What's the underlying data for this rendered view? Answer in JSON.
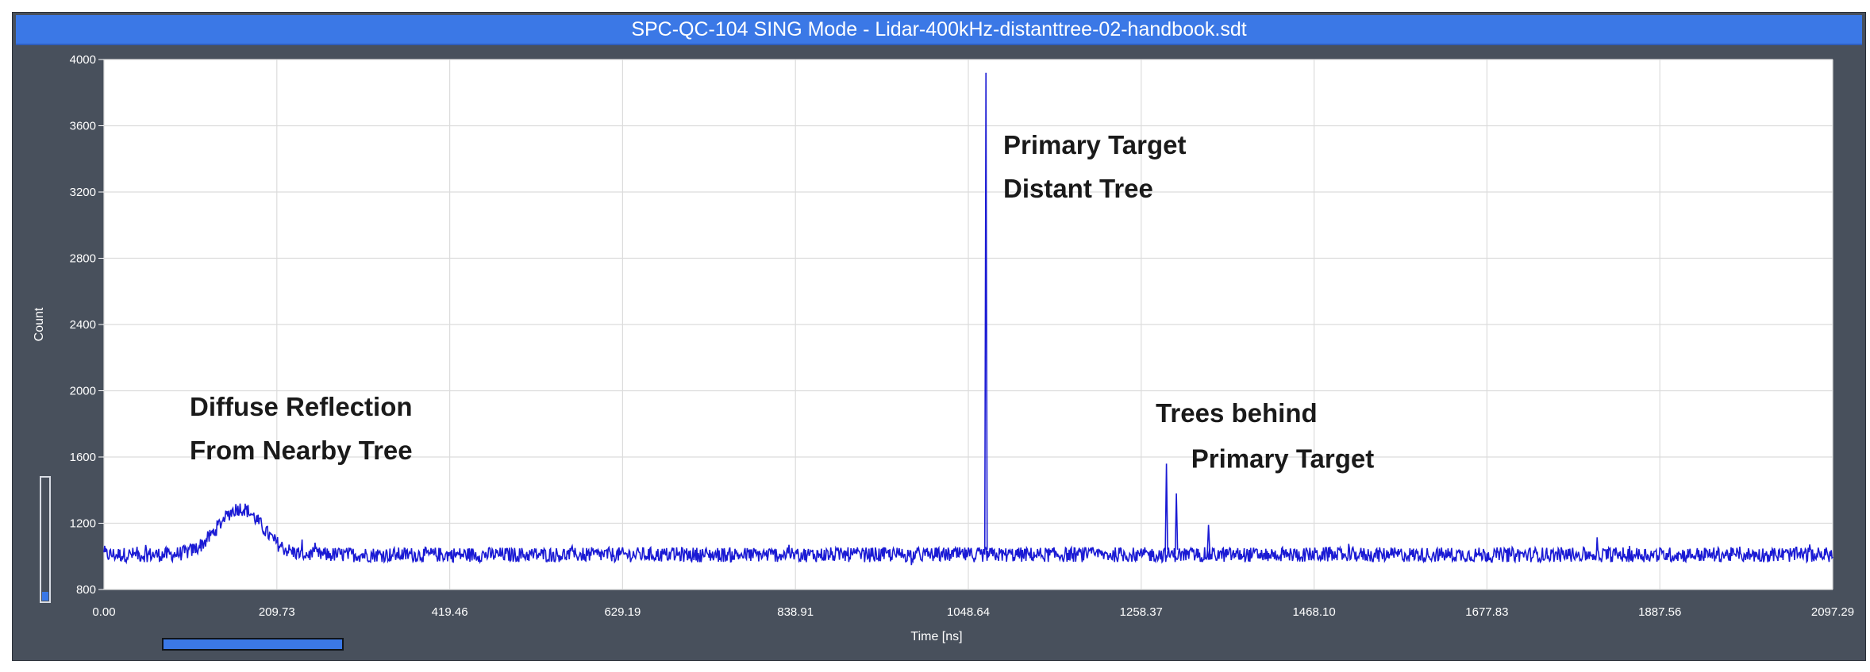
{
  "window": {
    "title": "SPC-QC-104  SING Mode - Lidar-400kHz-distanttree-02-handbook.sdt"
  },
  "colors": {
    "series": "#1a1ad4",
    "plot_bg": "#ffffff",
    "frame_bg": "#48505c",
    "title_bg": "#3b78e6",
    "scroll_accent": "#3b78e6"
  },
  "chart_data": {
    "type": "line",
    "title": "",
    "xlabel": "Time [ns]",
    "ylabel": "Count",
    "xlim": [
      0,
      2097.29
    ],
    "ylim": [
      800,
      4000
    ],
    "x_ticks": [
      "0.00",
      "209.73",
      "419.46",
      "629.19",
      "838.91",
      "1048.64",
      "1258.37",
      "1468.10",
      "1677.83",
      "1887.56",
      "2097.29"
    ],
    "y_ticks": [
      "800",
      "1200",
      "1600",
      "2000",
      "2400",
      "2800",
      "3200",
      "3600",
      "4000"
    ],
    "grid": true,
    "series": [
      {
        "baseline": 1010,
        "noise_band": 45,
        "features": [
          {
            "kind": "bump",
            "center": 165,
            "width": 38,
            "height": 1290
          },
          {
            "kind": "spike",
            "x": 1070,
            "peak": 3920
          },
          {
            "kind": "spike",
            "x": 1289,
            "peak": 1560
          },
          {
            "kind": "spike",
            "x": 1301,
            "peak": 1380
          },
          {
            "kind": "spike",
            "x": 1340,
            "peak": 1190
          }
        ]
      }
    ],
    "annotations": [
      {
        "lines": [
          "Primary Target",
          "Distant Tree"
        ],
        "x": 1091,
        "y": 3430
      },
      {
        "lines": [
          "Diffuse Reflection",
          "From Nearby Tree"
        ],
        "x": 104,
        "y": 1850
      },
      {
        "lines": [
          "Trees behind"
        ],
        "x": 1276,
        "y": 1810
      },
      {
        "lines": [
          "Primary Target"
        ],
        "x": 1319,
        "y": 1535
      }
    ]
  }
}
